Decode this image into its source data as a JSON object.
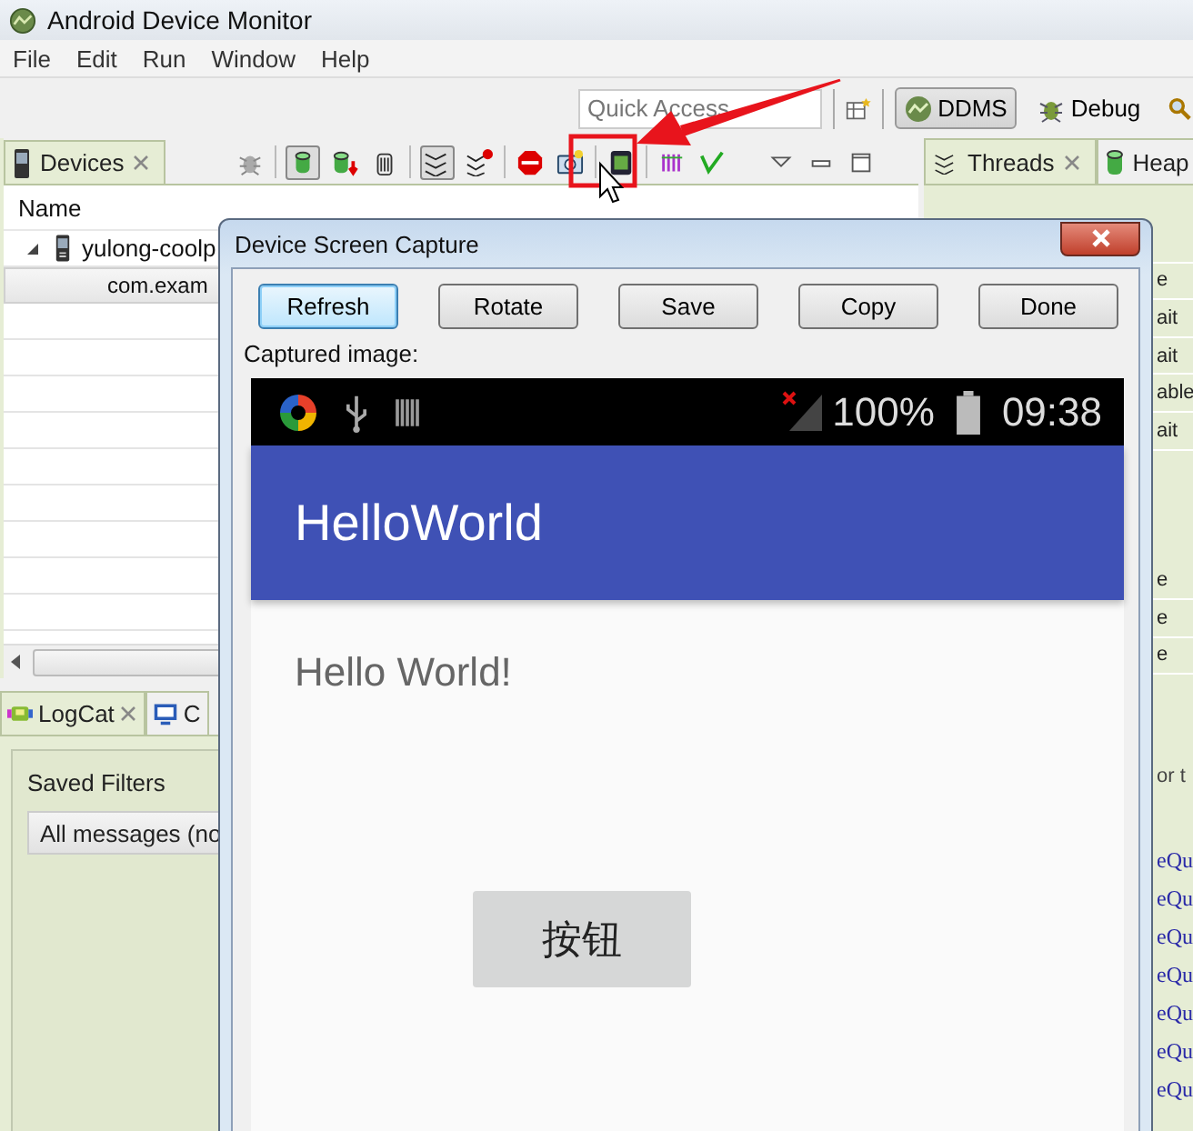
{
  "window": {
    "title": "Android Device Monitor"
  },
  "menu": [
    "File",
    "Edit",
    "Run",
    "Window",
    "Help"
  ],
  "toolbar": {
    "quick_access": {
      "placeholder": "Quick Access"
    },
    "perspectives": [
      {
        "label": "DDMS",
        "selected": true
      },
      {
        "label": "Debug",
        "selected": false
      }
    ]
  },
  "devices_view": {
    "tab": "Devices",
    "columns": [
      "Name"
    ],
    "rows": [
      {
        "name": "yulong-coolp",
        "kind": "device",
        "expanded": true,
        "selected": false
      },
      {
        "name": "com.exam",
        "kind": "process",
        "selected": true
      }
    ]
  },
  "logcat": {
    "tabs": [
      {
        "label": "LogCat",
        "selected": true
      },
      {
        "label": "C",
        "selected": false
      }
    ],
    "saved_filters_label": "Saved Filters",
    "filters": [
      {
        "label": "All messages (no",
        "selected": true
      }
    ]
  },
  "threads_view": {
    "tabs": [
      {
        "label": "Threads",
        "selected": true
      },
      {
        "label": "Heap",
        "selected": false
      }
    ],
    "rows_top": [
      "e",
      "ait",
      "ait",
      "able",
      "ait"
    ],
    "rows_bottom": [
      "e",
      "e",
      "e"
    ],
    "filter_fragment": "or t",
    "log_fragments": [
      "eQu",
      "eQu",
      "eQu",
      "eQu",
      "eQu",
      "eQu",
      "eQu"
    ]
  },
  "dialog": {
    "title": "Device Screen Capture",
    "buttons": [
      {
        "label": "Refresh",
        "focused": true
      },
      {
        "label": "Rotate",
        "focused": false
      },
      {
        "label": "Save",
        "focused": false
      },
      {
        "label": "Copy",
        "focused": false
      },
      {
        "label": "Done",
        "focused": false
      }
    ],
    "caption": "Captured image:",
    "screen": {
      "battery": "100%",
      "time": "09:38",
      "app_title": "HelloWorld",
      "body_text": "Hello World!",
      "button": "按钮"
    }
  }
}
